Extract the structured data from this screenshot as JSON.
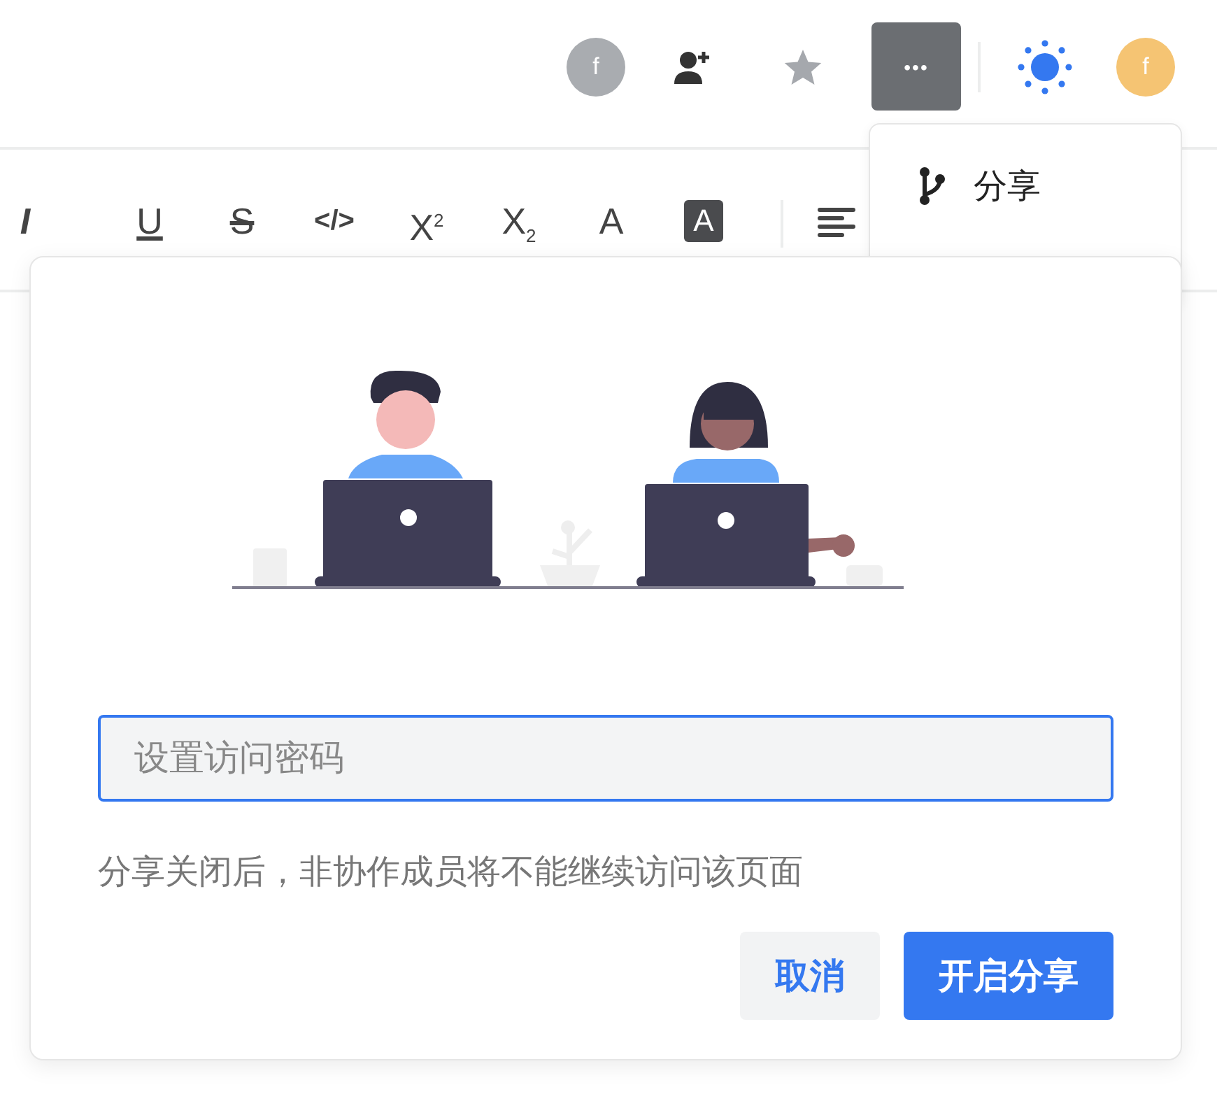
{
  "header": {
    "avatars": [
      {
        "initial": "f",
        "color": "#a9acb0"
      },
      {
        "initial": "f",
        "color": "#f5c473"
      }
    ],
    "more_button": {
      "glyph": "•••",
      "selected": true
    }
  },
  "toolbar": {
    "tools": [
      {
        "glyph": "I",
        "kind": "italic"
      },
      {
        "glyph": "U",
        "kind": "underline"
      },
      {
        "glyph": "S",
        "kind": "strike"
      },
      {
        "glyph": "</>",
        "kind": "code"
      },
      {
        "glyph": "X$^{2}$",
        "kind": "plain"
      },
      {
        "glyph": "X$_{2}$",
        "kind": "plain"
      },
      {
        "glyph": "A",
        "kind": "plain"
      },
      {
        "glyph": "A",
        "kind": "inverse"
      }
    ]
  },
  "menu": {
    "items": [
      {
        "label": "分享"
      }
    ]
  },
  "dialog": {
    "password": {
      "placeholder": "设置访问密码"
    },
    "note": "分享关闭后，非协作成员将不能继续访问该页面",
    "buttons": [
      {
        "label": "取消",
        "kind": "secondary"
      },
      {
        "label": "开启分享",
        "kind": "primary"
      }
    ]
  }
}
